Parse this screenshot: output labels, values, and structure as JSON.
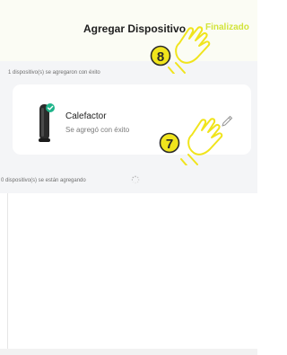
{
  "header": {
    "title": "Agregar Dispositivo",
    "done_label": "Finalizado"
  },
  "added": {
    "summary": "1 dispositivo(s) se agregaron con éxito",
    "device": {
      "name": "Calefactor",
      "status": "Se agregó con éxito",
      "icon": "tower-heater"
    }
  },
  "pending": {
    "summary": "0 dispositivo(s) se están agregando"
  },
  "annotations": [
    {
      "number": "8"
    },
    {
      "number": "7"
    }
  ],
  "colors": {
    "accent": "#d2e43b",
    "success": "#1fb48a",
    "annotation": "#f0e41c"
  }
}
